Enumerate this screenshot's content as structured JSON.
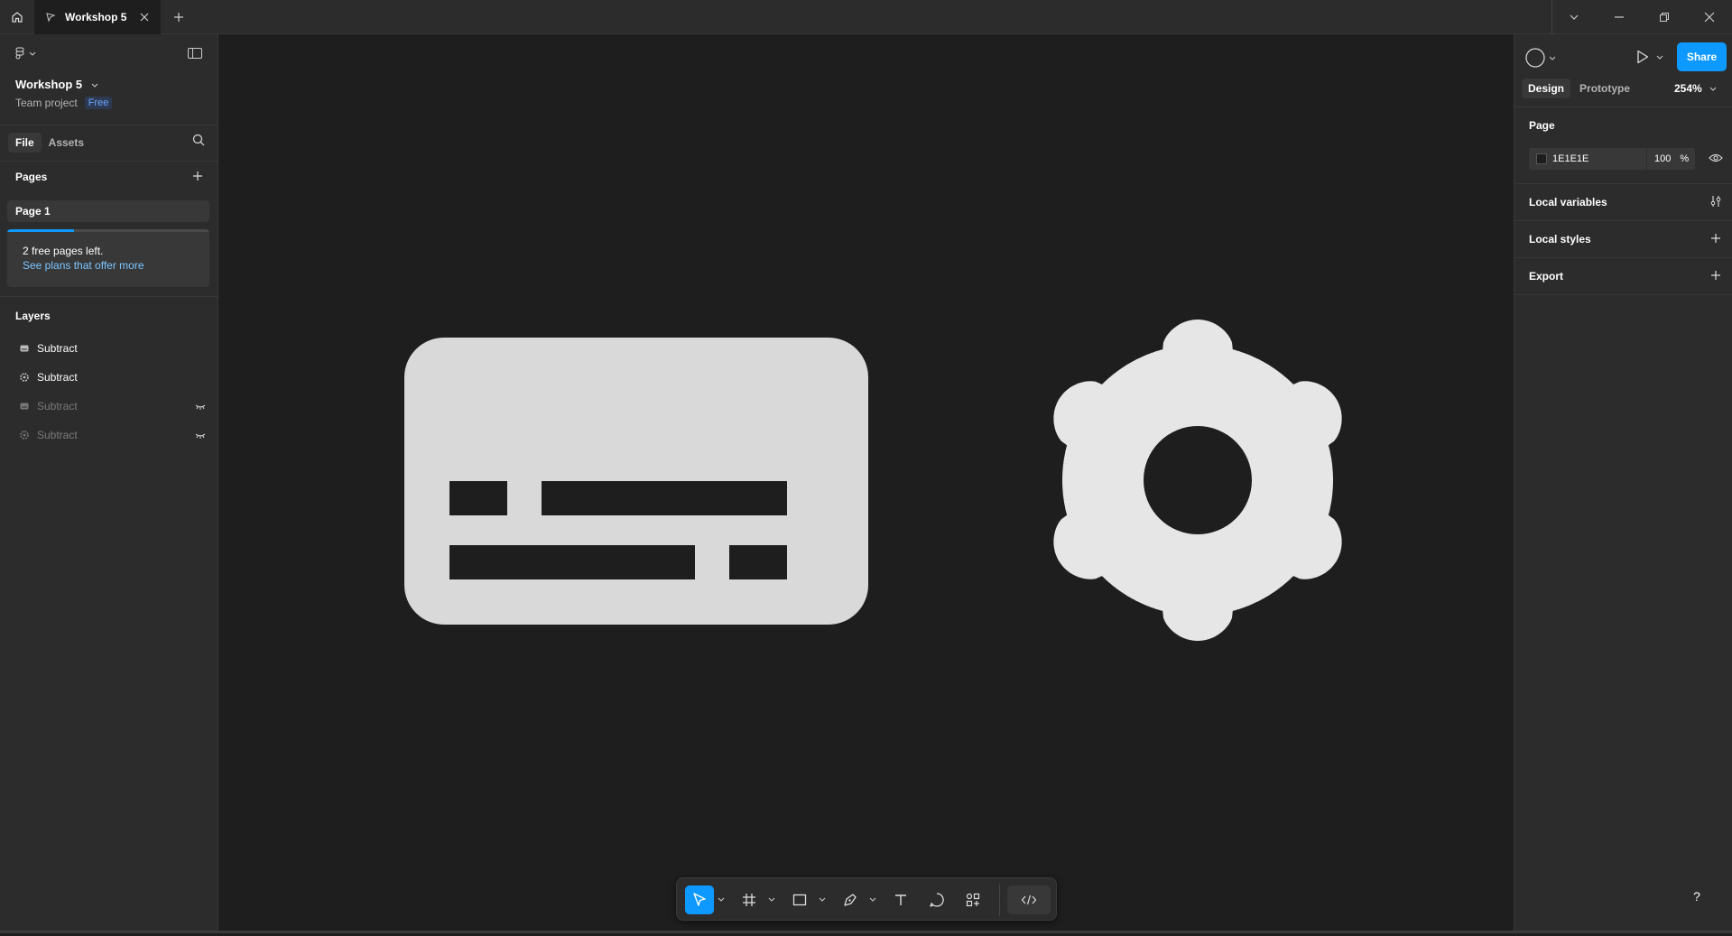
{
  "titlebar": {
    "tab_title": "Workshop 5",
    "icons": [
      "home-icon",
      "figma-file-icon",
      "close-icon",
      "plus-icon",
      "chevron-down-icon",
      "minimize-icon",
      "restore-icon",
      "window-close-icon"
    ]
  },
  "left_panel": {
    "file_name": "Workshop 5",
    "team_label": "Team project",
    "plan_badge": "Free",
    "tabs": [
      "File",
      "Assets"
    ],
    "pages_heading": "Pages",
    "pages": [
      {
        "label": "Page 1",
        "selected": true
      }
    ],
    "promo": {
      "line1": "2 free pages left.",
      "link": "See plans that offer more",
      "progress_fraction": 0.33
    },
    "layers_heading": "Layers",
    "layers": [
      {
        "label": "Subtract",
        "icon": "card-shape-icon",
        "visible": true
      },
      {
        "label": "Subtract",
        "icon": "gear-shape-icon",
        "visible": true
      },
      {
        "label": "Subtract",
        "icon": "card-shape-icon",
        "visible": false
      },
      {
        "label": "Subtract",
        "icon": "gear-shape-icon",
        "visible": false
      }
    ]
  },
  "right_panel": {
    "tabs": [
      "Design",
      "Prototype"
    ],
    "active_tab": "Design",
    "zoom": "254%",
    "share_label": "Share",
    "page_heading": "Page",
    "page_color": "1E1E1E",
    "page_opacity": "100",
    "opacity_unit": "%",
    "sections": [
      {
        "label": "Local variables",
        "icon": "sliders-icon"
      },
      {
        "label": "Local styles",
        "icon": "plus-icon"
      },
      {
        "label": "Export",
        "icon": "plus-icon"
      }
    ]
  },
  "canvas": {
    "background": "#1e1e1e",
    "shape_fill": "#d9d9d9",
    "gear_fill": "#e6e6e6"
  },
  "toolbar": {
    "tools": [
      "move-tool",
      "frame-tool",
      "rectangle-tool",
      "pen-tool",
      "text-tool",
      "comment-tool",
      "actions-tool",
      "dev-mode-toggle"
    ],
    "active_tool": "move-tool"
  },
  "help_label": "?",
  "colors": {
    "accent": "#0d99ff",
    "panel": "#2c2c2c",
    "link": "#7cc4ff"
  }
}
